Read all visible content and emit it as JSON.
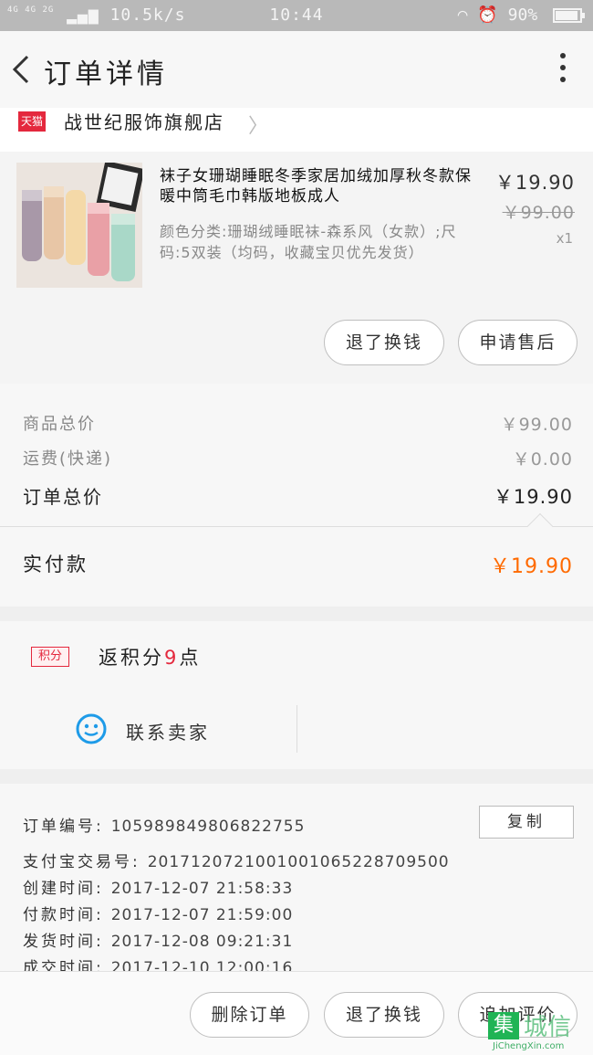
{
  "status_bar": {
    "network": "4G 4G 2G",
    "speed": "10.5k/s",
    "time": "10:44",
    "battery": "90%"
  },
  "header": {
    "title": "订单详情"
  },
  "shop": {
    "badge": "天猫",
    "name": "战世纪服饰旗舰店"
  },
  "product": {
    "title": "袜子女珊瑚睡眠冬季家居加绒加厚秋冬款保暖中筒毛巾韩版地板成人",
    "sku": "颜色分类:珊瑚绒睡眠袜-森系风（女款）;尺码:5双装（均码，收藏宝贝优先发货）",
    "price": "￥19.90",
    "original_price": "￥99.00",
    "quantity": "x1",
    "buttons": {
      "refund": "退了换钱",
      "after_sale": "申请售后"
    }
  },
  "summary": {
    "goods_total_label": "商品总价",
    "goods_total_value": "￥99.00",
    "shipping_label": "运费(快递)",
    "shipping_value": "￥0.00",
    "order_total_label": "订单总价",
    "order_total_value": "￥19.90",
    "paid_label": "实付款",
    "paid_value": "￥19.90"
  },
  "points": {
    "badge": "积分",
    "prefix": "返积分",
    "number": "9",
    "suffix": "点"
  },
  "contact": {
    "label": "联系卖家"
  },
  "order_info": {
    "copy_button": "复制",
    "rows": [
      {
        "label": "订单编号:",
        "value": "105989849806822755"
      },
      {
        "label": "支付宝交易号:",
        "value": "2017120721001001065228709500"
      },
      {
        "label": "创建时间:",
        "value": "2017-12-07 21:58:33"
      },
      {
        "label": "付款时间:",
        "value": "2017-12-07 21:59:00"
      },
      {
        "label": "发货时间:",
        "value": "2017-12-08 09:21:31"
      },
      {
        "label": "成交时间:",
        "value": "2017-12-10 12:00:16"
      }
    ]
  },
  "bottom_bar": {
    "delete": "删除订单",
    "refund": "退了换钱",
    "review": "追加评价"
  },
  "watermark": {
    "logo": "集",
    "text": "城信",
    "url": "JiChengXin.com"
  },
  "colors": {
    "accent_orange": "#ff6a00",
    "tmall_red": "#e4283d",
    "contact_blue": "#1e9be8"
  }
}
